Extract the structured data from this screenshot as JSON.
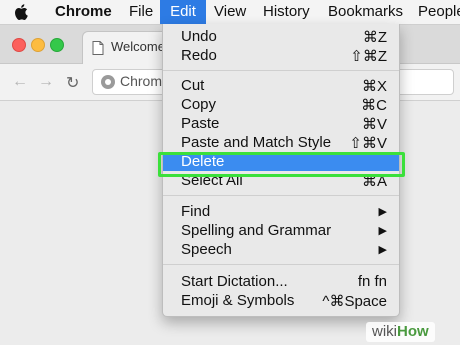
{
  "menubar": {
    "app": "Chrome",
    "items": [
      "File",
      "Edit",
      "View",
      "History",
      "Bookmarks",
      "People"
    ]
  },
  "browser": {
    "tab_title": "Welcome",
    "url_text": "Chrom"
  },
  "edit_menu": {
    "undo": {
      "label": "Undo",
      "shortcut": "⌘Z"
    },
    "redo": {
      "label": "Redo",
      "shortcut": "⇧⌘Z"
    },
    "cut": {
      "label": "Cut",
      "shortcut": "⌘X"
    },
    "copy": {
      "label": "Copy",
      "shortcut": "⌘C"
    },
    "paste": {
      "label": "Paste",
      "shortcut": "⌘V"
    },
    "paste_match": {
      "label": "Paste and Match Style",
      "shortcut": "⇧⌘V"
    },
    "delete": {
      "label": "Delete",
      "shortcut": ""
    },
    "select_all": {
      "label": "Select All",
      "shortcut": "⌘A"
    },
    "find": {
      "label": "Find"
    },
    "spelling": {
      "label": "Spelling and Grammar"
    },
    "speech": {
      "label": "Speech"
    },
    "dictation": {
      "label": "Start Dictation...",
      "shortcut": "fn fn"
    },
    "emoji": {
      "label": "Emoji & Symbols",
      "shortcut": "^⌘Space"
    }
  },
  "colors": {
    "menu_highlight": "#3b8cf0",
    "annotation_box": "#3be03b"
  },
  "watermark": {
    "part1": "wiki",
    "part2": "How"
  }
}
